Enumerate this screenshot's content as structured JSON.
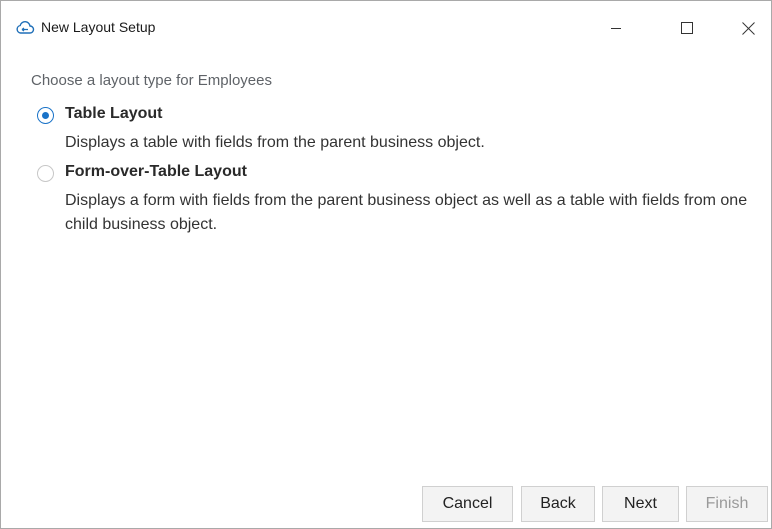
{
  "window": {
    "title": "New Layout Setup",
    "app_icon": "cloud-app-icon",
    "controls": {
      "minimize_icon": "minimize-icon",
      "maximize_icon": "maximize-icon",
      "close_icon": "close-icon"
    }
  },
  "content": {
    "prompt": "Choose a layout type for Employees",
    "options": [
      {
        "label": "Table Layout",
        "description": "Displays a table with fields from the parent business object.",
        "selected": true
      },
      {
        "label": "Form-over-Table Layout",
        "description": "Displays a form with fields from the parent business object as well as a table with fields from one child business object.",
        "selected": false
      }
    ]
  },
  "footer": {
    "cancel_label": "Cancel",
    "back_label": "Back",
    "next_label": "Next",
    "finish_label": "Finish",
    "finish_enabled": false
  },
  "colors": {
    "accent": "#1a73c8",
    "disabled_text": "#9a9a9a",
    "prompt_text": "#5f6368"
  }
}
